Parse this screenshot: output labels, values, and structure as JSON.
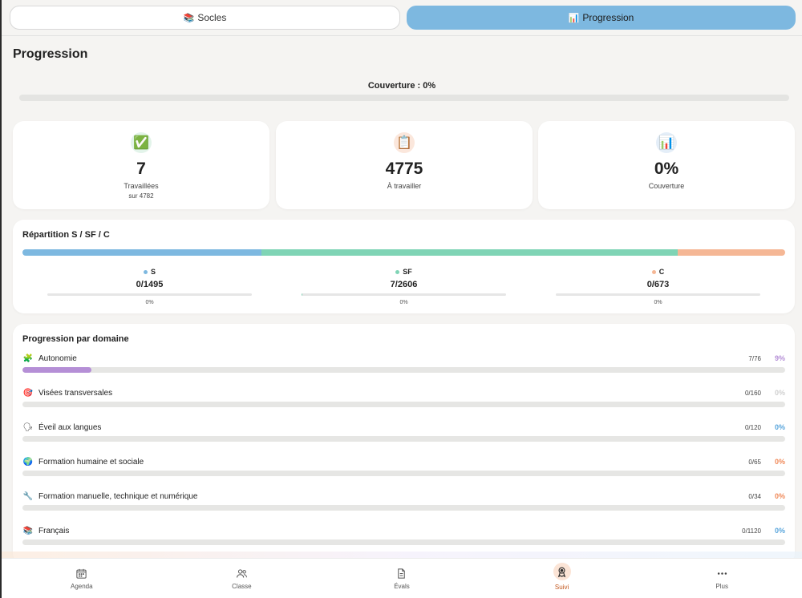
{
  "tabs": [
    {
      "icon": "📚",
      "label": "Socles",
      "active": false
    },
    {
      "icon": "📊",
      "label": "Progression",
      "active": true
    }
  ],
  "page": {
    "title": "Progression"
  },
  "coverage": {
    "label": "Couverture : 0%",
    "progress": 0
  },
  "stats": [
    {
      "icon": "✅",
      "icon_name": "checkbox-icon",
      "icon_bg": "#e3f4ea",
      "value": "7",
      "label": "Travaillées",
      "sub": "sur 4782"
    },
    {
      "icon": "📋",
      "icon_name": "clipboard-icon",
      "icon_bg": "#fbe7dc",
      "value": "4775",
      "label": "À travailler",
      "sub": ""
    },
    {
      "icon": "📊",
      "icon_name": "bar-chart-icon",
      "icon_bg": "#e4eef8",
      "value": "0%",
      "label": "Couverture",
      "sub": ""
    }
  ],
  "repartition": {
    "title": "Répartition S / SF / C",
    "stack": [
      {
        "key": "S",
        "share": 1495,
        "color": "#7db8e0"
      },
      {
        "key": "SF",
        "share": 2606,
        "color": "#7fd4b5"
      },
      {
        "key": "C",
        "share": 673,
        "color": "#f5b795"
      }
    ],
    "items": [
      {
        "name": "S",
        "color": "#7db8e0",
        "count": "0/1495",
        "pct": "0%",
        "progress": 0
      },
      {
        "name": "SF",
        "color": "#7fd4b5",
        "count": "7/2606",
        "pct": "0%",
        "progress": 0.27
      },
      {
        "name": "C",
        "color": "#f5b795",
        "count": "0/673",
        "pct": "0%",
        "progress": 0
      }
    ]
  },
  "domains": {
    "title": "Progression par domaine",
    "items": [
      {
        "icon": "🧩",
        "icon_name": "puzzle-icon",
        "name": "Autonomie",
        "count": "7/76",
        "pct": "9%",
        "color": "#b58fd6",
        "progress": 9
      },
      {
        "icon": "🎯",
        "icon_name": "target-icon",
        "name": "Visées transversales",
        "count": "0/160",
        "pct": "0%",
        "color": "#d0d0d0",
        "progress": 0
      },
      {
        "icon": "🗣",
        "icon_name": "speaking-head-icon",
        "name": "Éveil aux langues",
        "count": "0/120",
        "pct": "0%",
        "color": "#5aa6dc",
        "progress": 0
      },
      {
        "icon": "🌍",
        "icon_name": "globe-icon",
        "name": "Formation humaine et sociale",
        "count": "0/65",
        "pct": "0%",
        "color": "#f08a5a",
        "progress": 0
      },
      {
        "icon": "🔧",
        "icon_name": "wrench-icon",
        "name": "Formation manuelle, technique et numérique",
        "count": "0/34",
        "pct": "0%",
        "color": "#f08a5a",
        "progress": 0
      },
      {
        "icon": "📚",
        "icon_name": "books-icon",
        "name": "Français",
        "count": "0/1120",
        "pct": "0%",
        "color": "#5aa6dc",
        "progress": 0
      }
    ]
  },
  "nav": [
    {
      "label": "Agenda",
      "icon_name": "calendar-icon",
      "active": false
    },
    {
      "label": "Classe",
      "icon_name": "users-icon",
      "active": false
    },
    {
      "label": "Évals",
      "icon_name": "document-icon",
      "active": false
    },
    {
      "label": "Suivi",
      "icon_name": "award-icon",
      "active": true
    },
    {
      "label": "Plus",
      "icon_name": "more-icon",
      "active": false
    }
  ]
}
